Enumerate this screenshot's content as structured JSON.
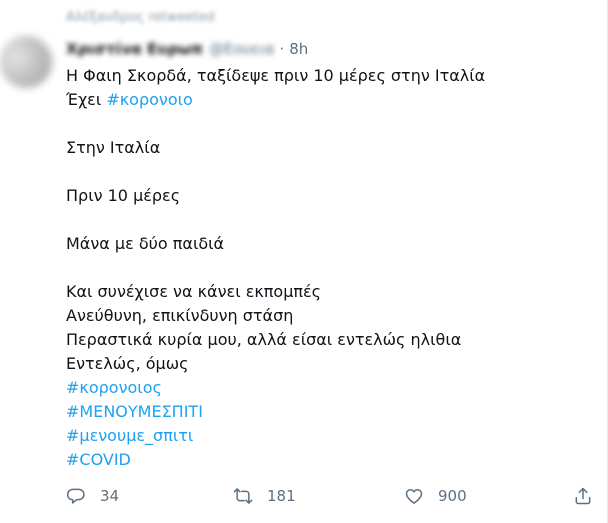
{
  "tweet": {
    "retweet_line": "Αλέξανδρος retweeted",
    "author": {
      "name": "Χριστίνα Ευρωπ",
      "handle": "@Εουεια",
      "time": "8h"
    },
    "text": {
      "line1": "Η Φαιη Σκορδά, ταξίδεψε πριν 10 μέρες στην Ιταλία",
      "line2_prefix": "Έχει ",
      "line2_hashtag": "#κορονοιο",
      "para2": "Στην Ιταλία",
      "para3": "Πριν 10 μέρες",
      "para4": "Μάνα με δύο παιδιά",
      "para5": [
        "Και συνέχισε να κάνει εκπομπές",
        "Ανεύθυνη, επικίνδυνη στάση",
        "Περαστικά κυρία μου, αλλά είσαι εντελώς ηλιθια",
        "Εντελώς, όμως"
      ],
      "hashtags": [
        "#κορονοιος",
        "#ΜΕΝΟΥΜΕΣΠΙΤΙ",
        "#μενουμε_σπιτι",
        "#COVID"
      ]
    },
    "actions": {
      "reply": {
        "icon": "reply-icon",
        "count": "34"
      },
      "retweet": {
        "icon": "retweet-icon",
        "count": "181"
      },
      "like": {
        "icon": "heart-icon",
        "count": "900"
      },
      "share": {
        "icon": "share-icon"
      }
    },
    "colors": {
      "link": "#1da1f2",
      "secondary": "#5b7083",
      "text": "#0f1419"
    }
  }
}
